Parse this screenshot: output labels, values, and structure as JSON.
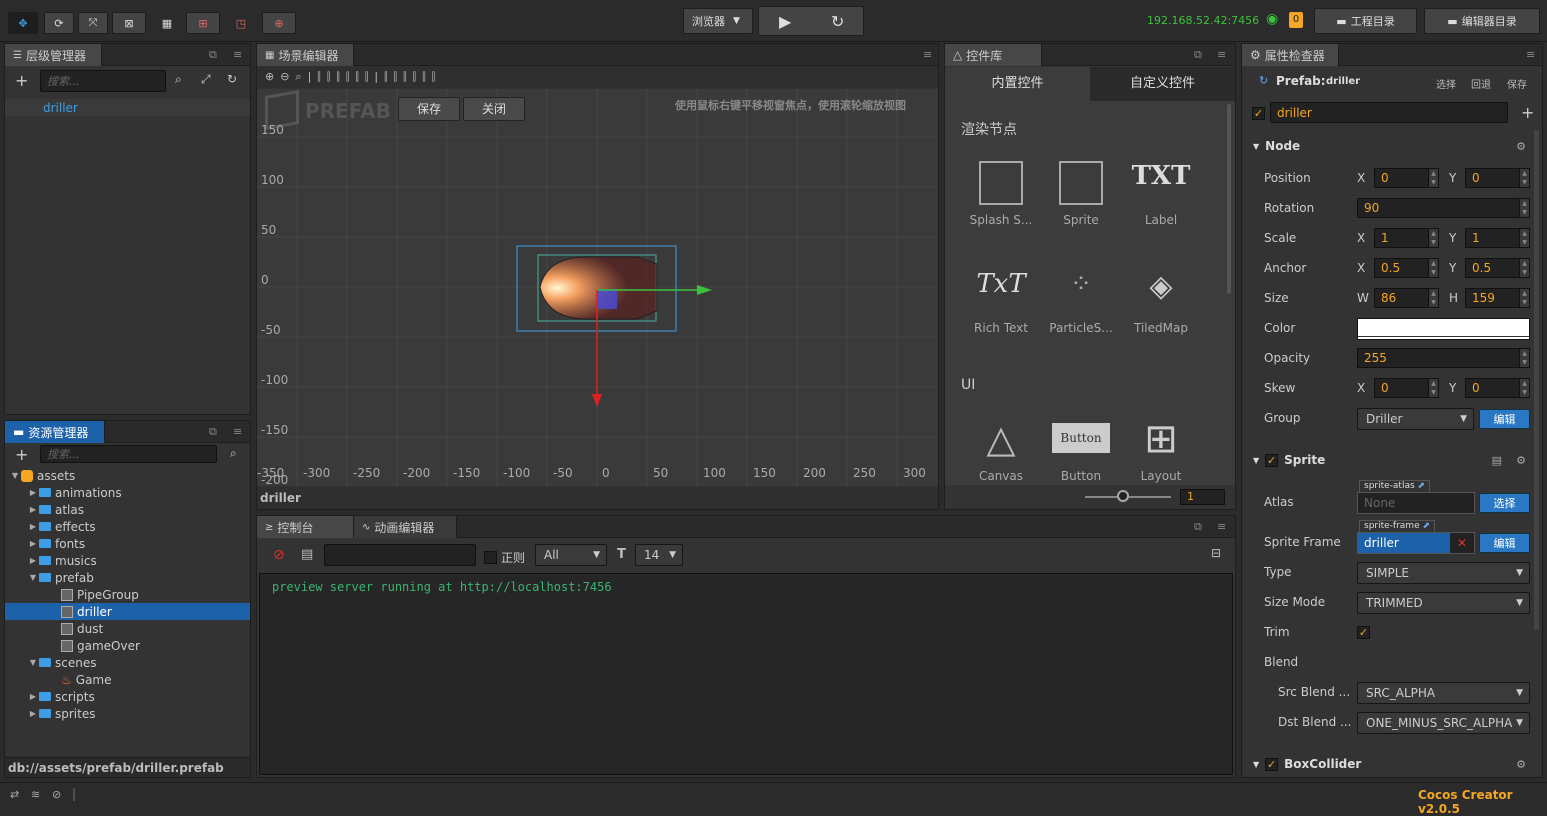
{
  "toolbar": {
    "browser_label": "浏览器",
    "ip": "192.168.52.42:7456",
    "badge": "0",
    "project_dir": "工程目录",
    "editor_dir": "编辑器目录"
  },
  "hierarchy": {
    "title": "层级管理器",
    "search_placeholder": "搜索...",
    "items": [
      "driller"
    ]
  },
  "assets": {
    "title": "资源管理器",
    "search_placeholder": "搜索...",
    "tree": [
      {
        "label": "assets"
      },
      {
        "label": "animations"
      },
      {
        "label": "atlas"
      },
      {
        "label": "effects"
      },
      {
        "label": "fonts"
      },
      {
        "label": "musics"
      },
      {
        "label": "prefab"
      },
      {
        "label": "PipeGroup"
      },
      {
        "label": "driller"
      },
      {
        "label": "dust"
      },
      {
        "label": "gameOver"
      },
      {
        "label": "scenes"
      },
      {
        "label": "Game"
      },
      {
        "label": "scripts"
      },
      {
        "label": "sprites"
      }
    ],
    "path": "db://assets/prefab/driller.prefab"
  },
  "scene": {
    "title": "场景编辑器",
    "prefab_label": "PREFAB",
    "save": "保存",
    "close": "关闭",
    "hint": "使用鼠标右键平移视窗焦点，使用滚轮缩放视图",
    "y_labels": [
      "150",
      "100",
      "50",
      "0",
      "-50",
      "-100",
      "-150",
      "-200"
    ],
    "x_labels": [
      "-350",
      "-300",
      "-250",
      "-200",
      "-150",
      "-100",
      "-50",
      "0",
      "50",
      "100",
      "150",
      "200",
      "250",
      "300"
    ],
    "footer": "driller"
  },
  "widgets": {
    "title": "控件库",
    "tab_builtin": "内置控件",
    "tab_custom": "自定义控件",
    "section_render": "渲染节点",
    "render_items": [
      "Splash S...",
      "Sprite",
      "Label",
      "Rich Text",
      "ParticleS...",
      "TiledMap"
    ],
    "section_ui": "UI",
    "ui_items": [
      "Canvas",
      "Button",
      "Layout"
    ],
    "button_text": "Button",
    "txt1": "TXT",
    "txt2": "TxT",
    "zoom_value": "1"
  },
  "console": {
    "title": "控制台",
    "anim_title": "动画编辑器",
    "regex": "正则",
    "level": "All",
    "font_size": "14",
    "log": "preview server running at http://localhost:7456"
  },
  "inspector": {
    "title": "属性检查器",
    "prefab_label": "Prefab:",
    "prefab_name": "driller",
    "select": "选择",
    "revert": "回退",
    "save": "保存",
    "node_name": "driller",
    "node_section": "Node",
    "position": {
      "label": "Position",
      "x": "0",
      "y": "0"
    },
    "rotation": {
      "label": "Rotation",
      "value": "90"
    },
    "scale": {
      "label": "Scale",
      "x": "1",
      "y": "1"
    },
    "anchor": {
      "label": "Anchor",
      "x": "0.5",
      "y": "0.5"
    },
    "size": {
      "label": "Size",
      "w": "86",
      "h": "159"
    },
    "color": {
      "label": "Color",
      "value": "#ffffff"
    },
    "opacity": {
      "label": "Opacity",
      "value": "255"
    },
    "skew": {
      "label": "Skew",
      "x": "0",
      "y": "0"
    },
    "group": {
      "label": "Group",
      "value": "Driller",
      "edit": "编辑"
    },
    "sprite_section": "Sprite",
    "atlas": {
      "label": "Atlas",
      "tag": "sprite-atlas",
      "value": "None",
      "btn": "选择"
    },
    "sprite_frame": {
      "label": "Sprite Frame",
      "tag": "sprite-frame",
      "value": "driller",
      "btn": "编辑"
    },
    "type": {
      "label": "Type",
      "value": "SIMPLE"
    },
    "size_mode": {
      "label": "Size Mode",
      "value": "TRIMMED"
    },
    "trim": {
      "label": "Trim"
    },
    "blend": {
      "label": "Blend"
    },
    "src_blend": {
      "label": "Src Blend ...",
      "value": "SRC_ALPHA"
    },
    "dst_blend": {
      "label": "Dst Blend ...",
      "value": "ONE_MINUS_SRC_ALPHA"
    },
    "box_section": "BoxCollider",
    "axis_x": "X",
    "axis_y": "Y",
    "axis_w": "W",
    "axis_h": "H"
  },
  "status": {
    "version": "Cocos Creator v2.0.5"
  },
  "colors": {
    "accent": "#f5a623",
    "selection": "#1d62a8",
    "ip_green": "#3cc13c",
    "console_text": "#3cb371"
  }
}
